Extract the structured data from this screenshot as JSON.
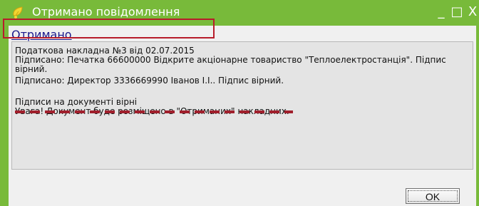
{
  "window": {
    "title": "Отримано повідомлення",
    "icon": "leaf-icon",
    "controls": {
      "minimize": "_",
      "maximize": "□",
      "close": "X"
    }
  },
  "content": {
    "link_label": "Отримано",
    "highlight_line": "Податкова накладна  №3 від 02.07.2015",
    "lines": [
      "Підписано: Печатка 66600000 Відкрите акціонарне товариство \"Теплоелектростанція\". Підпис вірний.",
      "Підписано: Директор 3336669990 Іванов І.І.. Підпис вірний.",
      "Підписи на документі вірні",
      "Увага! Документ буде розміщено в \"Отриманих\" накладних."
    ]
  },
  "buttons": {
    "ok_label": "OK"
  },
  "colors": {
    "titlebar": "#78ba3a",
    "highlight_border": "#b71c2a",
    "dashed_underline": "#a01f2c"
  }
}
